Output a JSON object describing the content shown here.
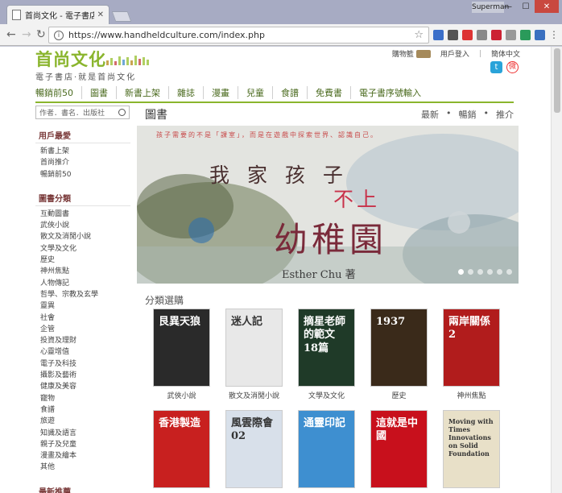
{
  "browser": {
    "tab_title": "首尚文化 - 電子書店 - 戰",
    "user": "Superman",
    "url": "https://www.handheldculture.com/index.php"
  },
  "header": {
    "logo_text": "首尚文化",
    "slogan": "電子書店·就是首尚文化",
    "cart": "購物籃",
    "login": "用戶登入",
    "lang": "簡体中文"
  },
  "nav": [
    "暢銷前50",
    "圖書",
    "新書上架",
    "雜誌",
    "漫畫",
    "兒童",
    "食譜",
    "免費書",
    "電子書序號輸入"
  ],
  "search": {
    "placeholder": "作者．書名．出版社"
  },
  "sidebar": {
    "fav_title": "用戶最愛",
    "fav_items": [
      "新書上架",
      "首尚推介",
      "暢銷前50"
    ],
    "cat_title": "圖書分類",
    "cat_items": [
      "互動圖書",
      "武俠小說",
      "散文及消閒小說",
      "文學及文化",
      "歷史",
      "神州焦點",
      "人物傳記",
      "哲學、宗教及玄學",
      "靈異",
      "社會",
      "企管",
      "投資及理財",
      "心靈增值",
      "電子及科技",
      "攝影及藝術",
      "健康及美容",
      "寵物",
      "食譜",
      "旅遊",
      "知識及語言",
      "親子及兒童",
      "漫畫及繪本",
      "其他"
    ],
    "recommend_title": "最新推薦"
  },
  "main": {
    "category": "圖書",
    "filters": [
      "最新",
      "•",
      "暢銷",
      "•",
      "推介"
    ],
    "browse_title": "分類選購"
  },
  "hero": {
    "quote": "孩子需要的不是「課室」，而是在遊戲中探索世界、認識自己。",
    "line1": "我 家 孩 子",
    "line2": "不上",
    "line3": "幼稚園",
    "author": "Esther Chu 著"
  },
  "books": [
    {
      "label": "武俠小說",
      "cover_text": "艮異天狼",
      "color": "#2a2a2a"
    },
    {
      "label": "散文及消閒小說",
      "cover_text": "迷人記",
      "color": "#e8e8e8"
    },
    {
      "label": "文學及文化",
      "cover_text": "摘星老師的範文18篇",
      "color": "#1f3a28"
    },
    {
      "label": "歷史",
      "cover_text": "1937",
      "color": "#3a2a1a"
    },
    {
      "label": "神州焦點",
      "cover_text": "兩岸關係2",
      "color": "#b11c1c"
    },
    {
      "label": "",
      "cover_text": "香港製造",
      "color": "#c8201f"
    },
    {
      "label": "",
      "cover_text": "風雲際會02",
      "color": "#d8e0ea"
    },
    {
      "label": "",
      "cover_text": "通靈印記",
      "color": "#3e8fd0"
    },
    {
      "label": "",
      "cover_text": "這就是中國",
      "color": "#c8101c"
    },
    {
      "label": "",
      "cover_text": "Moving with Times Innovations on Solid Foundation",
      "color": "#e8e0c8"
    }
  ]
}
